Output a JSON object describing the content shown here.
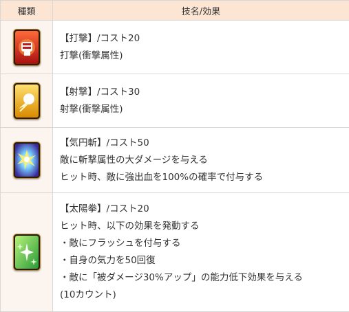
{
  "table": {
    "headers": [
      "種類",
      "技名/効果"
    ],
    "rows": [
      {
        "icon": "fist-card-icon",
        "name_line": "【打撃】/コスト20",
        "lines": [
          "打撃(衝撃属性)"
        ]
      },
      {
        "icon": "shot-card-icon",
        "name_line": "【射撃】/コスト30",
        "lines": [
          "射撃(衝撃属性)"
        ]
      },
      {
        "icon": "burst-slash-card-icon",
        "name_line": "【気円斬】/コスト50",
        "lines": [
          "敵に斬撃属性の大ダメージを与える",
          "ヒット時、敵に強出血を100%の確率で付与する"
        ]
      },
      {
        "icon": "sparkle-card-icon",
        "name_line": "【太陽拳】/コスト20",
        "lines": [
          "ヒット時、以下の効果を発動する",
          "・敵にフラッシュを付与する",
          "・自身の気力を50回復",
          "・敵に「被ダメージ30%アップ」の能力低下効果を与える",
          "(10カウント)"
        ]
      }
    ]
  },
  "colors": {
    "header_bg": "#fce5d2",
    "icon_cell_bg": "#fcf5ef",
    "border": "#d7d7d7"
  }
}
